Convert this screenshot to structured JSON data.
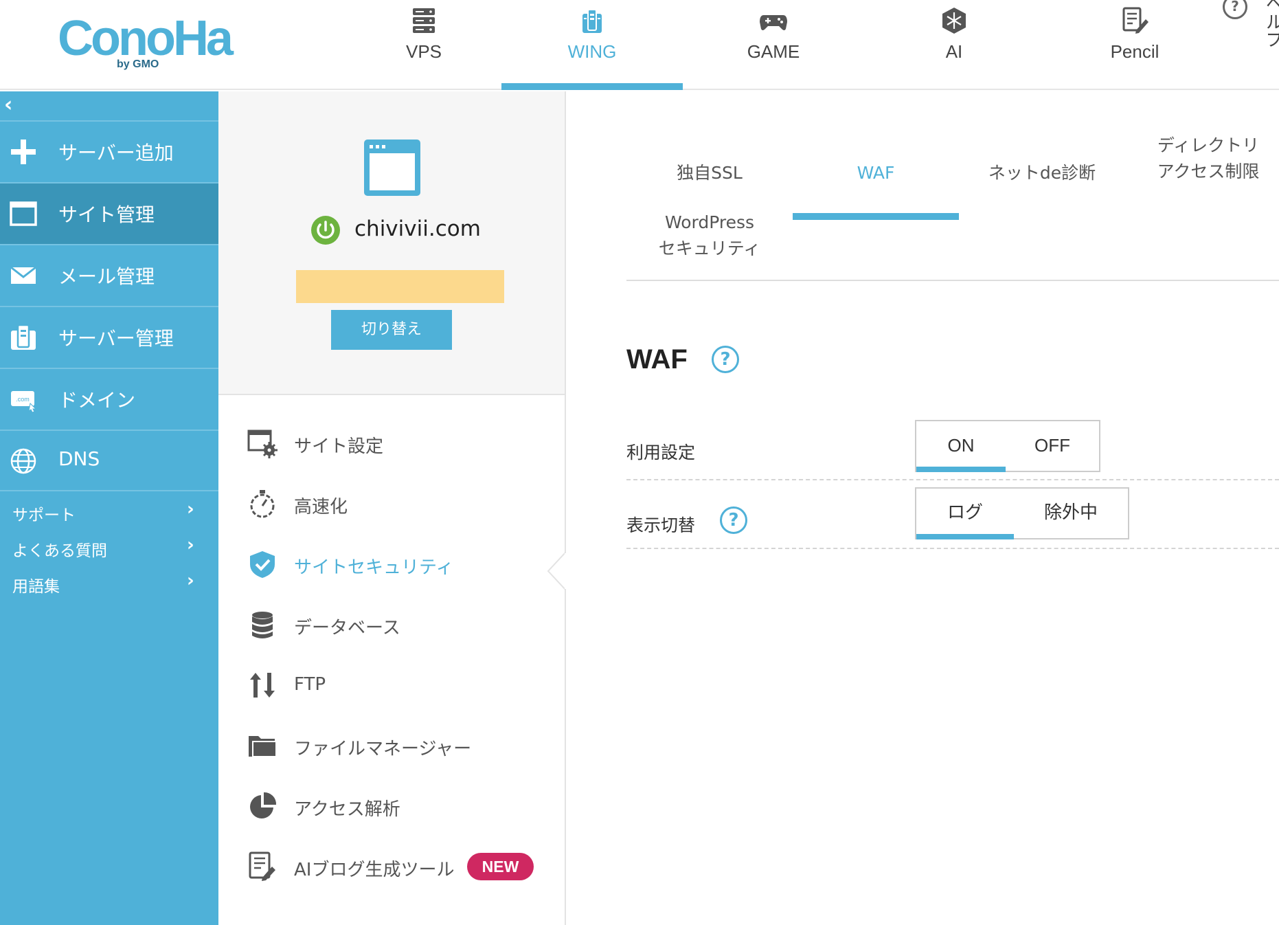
{
  "brand": {
    "logo_text": "ConoHa",
    "logo_sub": "by GMO",
    "accent": "#4fb1d8",
    "sidebar_bg": "#4fb1d8",
    "sidebar_active_bg": "#3a95b8",
    "badge_color": "#cf2861"
  },
  "topnav": {
    "items": [
      {
        "label": "VPS",
        "icon": "server-icon"
      },
      {
        "label": "WING",
        "icon": "wing-icon",
        "active": true
      },
      {
        "label": "GAME",
        "icon": "gamepad-icon"
      },
      {
        "label": "AI",
        "icon": "ai-icon"
      },
      {
        "label": "Pencil",
        "icon": "pencil-icon"
      }
    ],
    "help_label": "ヘルプ"
  },
  "sidebar": {
    "collapse_glyph": "‹",
    "items": [
      {
        "label": "サーバー追加",
        "icon": "plus-icon"
      },
      {
        "label": "サイト管理",
        "icon": "browser-window-icon",
        "active": true
      },
      {
        "label": "メール管理",
        "icon": "mail-icon"
      },
      {
        "label": "サーバー管理",
        "icon": "server-manage-icon"
      },
      {
        "label": "ドメイン",
        "icon": "domain-com-icon"
      },
      {
        "label": "DNS",
        "icon": "globe-icon"
      }
    ],
    "links": [
      {
        "label": "サポート",
        "arrow": "›"
      },
      {
        "label": "よくある質問",
        "arrow": "›"
      },
      {
        "label": "用語集",
        "arrow": "›"
      }
    ]
  },
  "site_panel": {
    "domain": "chivivii.com",
    "status_icon": "power-on-icon",
    "switch_label": "切り替え",
    "menu": [
      {
        "label": "サイト設定",
        "icon": "site-settings-icon"
      },
      {
        "label": "高速化",
        "icon": "stopwatch-icon"
      },
      {
        "label": "サイトセキュリティ",
        "icon": "shield-check-icon",
        "active": true
      },
      {
        "label": "データベース",
        "icon": "database-icon"
      },
      {
        "label": "FTP",
        "icon": "transfer-arrows-icon"
      },
      {
        "label": "ファイルマネージャー",
        "icon": "folder-icon"
      },
      {
        "label": "アクセス解析",
        "icon": "pie-chart-icon"
      },
      {
        "label": "AIブログ生成ツール",
        "icon": "ai-document-icon",
        "badge": "NEW"
      }
    ]
  },
  "main": {
    "tabs": [
      {
        "label": "独自SSL"
      },
      {
        "label": "WAF",
        "active": true
      },
      {
        "label": "ネットde診断"
      },
      {
        "label": "ディレクトリ\nアクセス制限"
      },
      {
        "label": "WordPress\nセキュリティ"
      }
    ],
    "section_title": "WAF",
    "help_glyph": "?",
    "settings": [
      {
        "label": "利用設定",
        "options": [
          "ON",
          "OFF"
        ],
        "selected": "ON"
      },
      {
        "label": "表示切替",
        "options": [
          "ログ",
          "除外中"
        ],
        "selected": "ログ"
      }
    ]
  }
}
